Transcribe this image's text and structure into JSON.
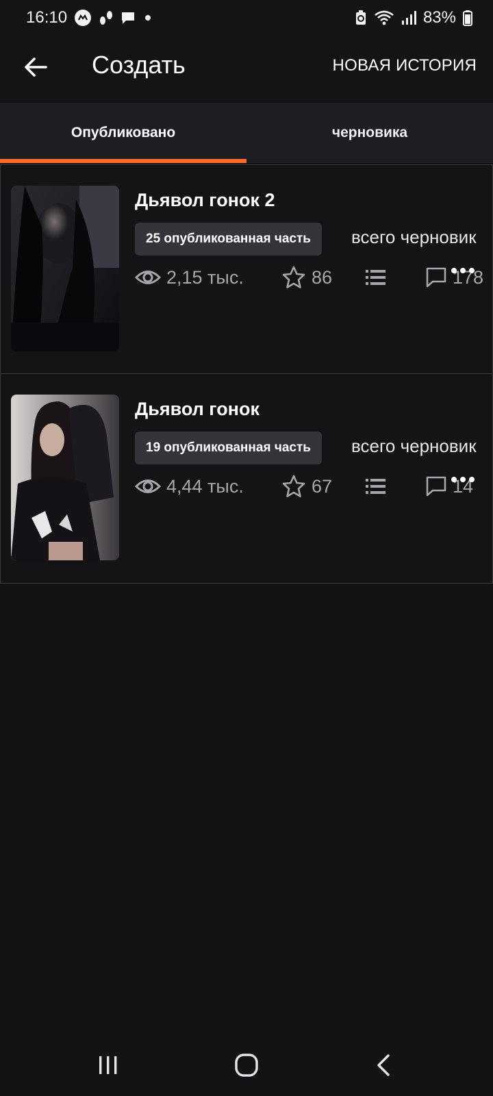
{
  "status_bar": {
    "time": "16:10",
    "battery": "83%",
    "icons": [
      "messenger-icon",
      "notification-icon",
      "chat-icon",
      "dot-icon",
      "battery-saver-icon",
      "wifi-icon",
      "signal-icon",
      "battery-icon"
    ]
  },
  "app_bar": {
    "title": "Создать",
    "action": "НОВАЯ ИСТОРИЯ"
  },
  "tabs": [
    {
      "label": "Опубликовано",
      "active": true
    },
    {
      "label": "черновика",
      "active": false
    }
  ],
  "colors": {
    "accent": "#ff6a2b",
    "background": "#131215",
    "badge": "#35343a"
  },
  "stories": [
    {
      "title": "Дьявол гонок 2",
      "published_badge": "25 опубликованная часть",
      "drafts_text": "всего черновик",
      "views": "2,15 тыс.",
      "votes": "86",
      "comments": "178"
    },
    {
      "title": "Дьявол гонок",
      "published_badge": "19 опубликованная часть",
      "drafts_text": "всего черновик",
      "views": "4,44 тыс.",
      "votes": "67",
      "comments": "14"
    }
  ]
}
